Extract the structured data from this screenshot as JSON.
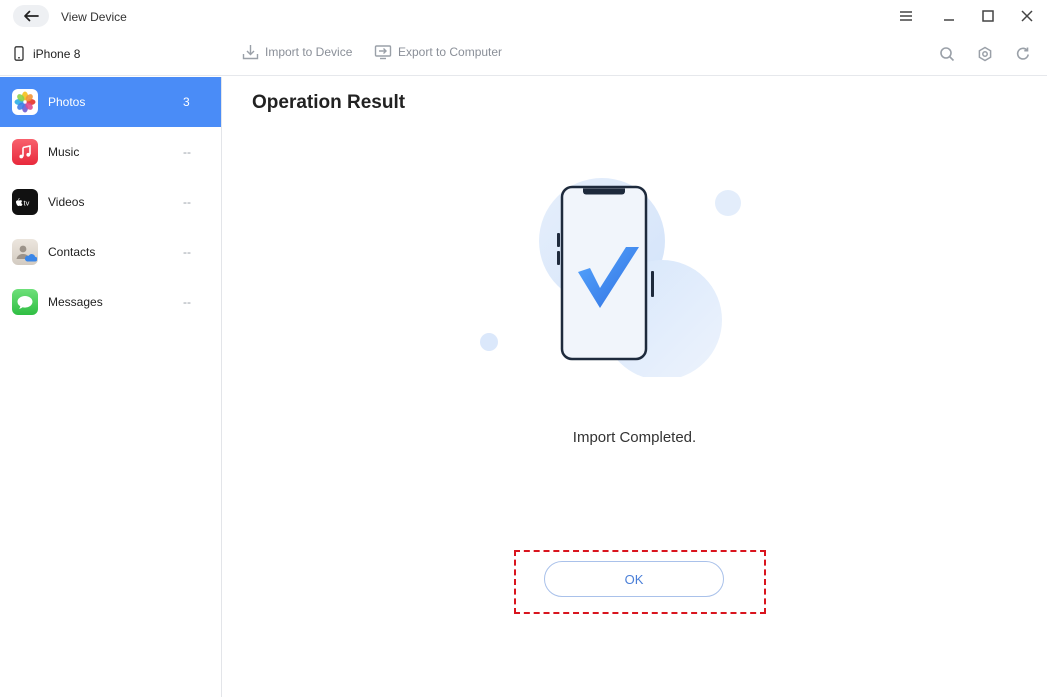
{
  "window": {
    "title": "View Device",
    "icons": [
      "back-arrow-icon",
      "menu-icon",
      "minimize-icon",
      "maximize-icon",
      "close-icon"
    ]
  },
  "device": {
    "name": "iPhone 8"
  },
  "toolbar": {
    "import_label": "Import to Device",
    "export_label": "Export to Computer",
    "right_icons": [
      "search-icon",
      "settings-icon",
      "refresh-icon"
    ]
  },
  "sidebar": {
    "items": [
      {
        "label": "Photos",
        "count": "3",
        "icon": "photos-icon",
        "active": true
      },
      {
        "label": "Music",
        "count": "--",
        "icon": "music-icon",
        "active": false
      },
      {
        "label": "Videos",
        "count": "--",
        "icon": "appletv-icon",
        "active": false
      },
      {
        "label": "Contacts",
        "count": "--",
        "icon": "contacts-icon",
        "active": false
      },
      {
        "label": "Messages",
        "count": "--",
        "icon": "messages-icon",
        "active": false
      }
    ]
  },
  "main": {
    "title": "Operation Result",
    "message": "Import Completed.",
    "ok_label": "OK"
  },
  "colors": {
    "accent": "#4a8cf7",
    "highlight_frame": "#d9141e",
    "check_mark": "#3f8df0"
  }
}
